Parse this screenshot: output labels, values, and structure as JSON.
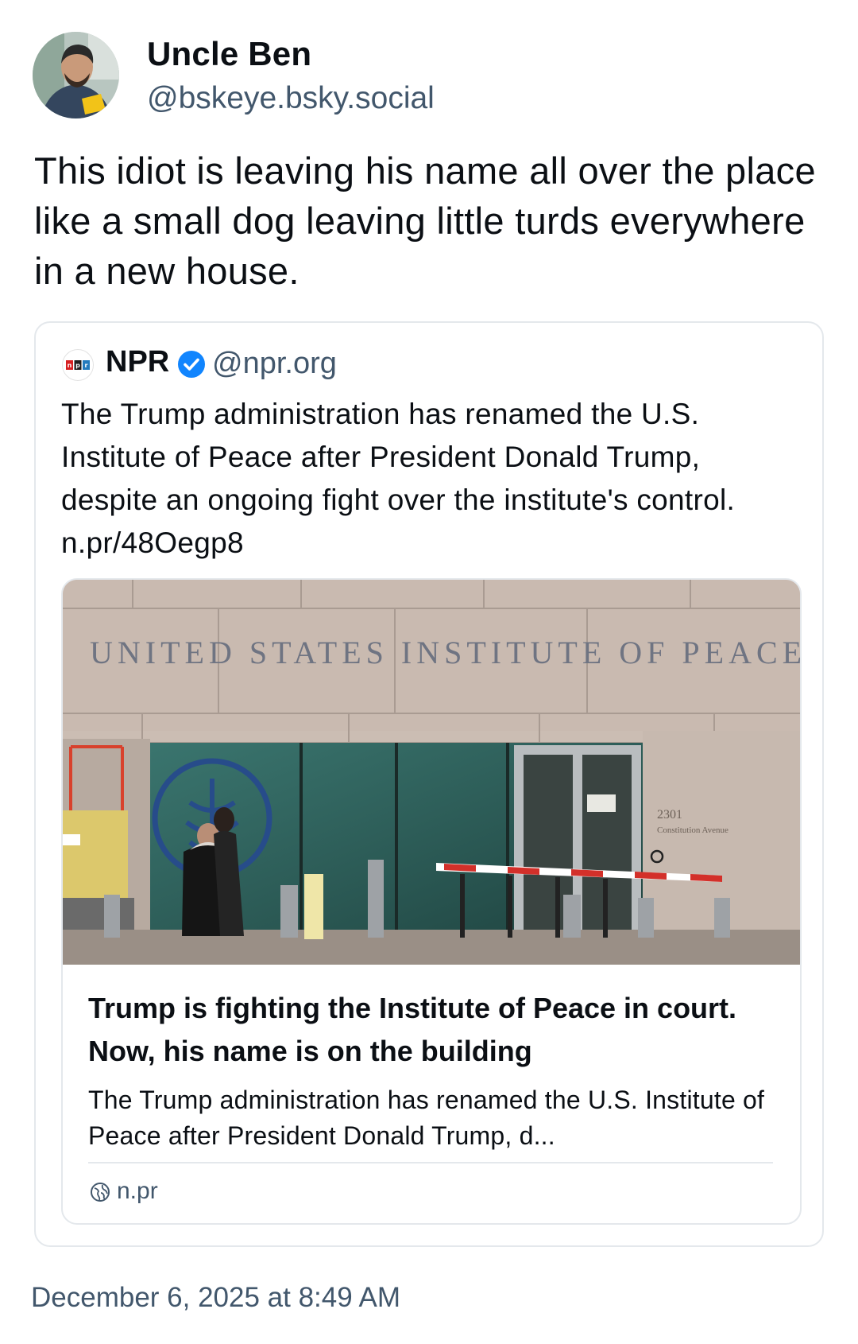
{
  "post": {
    "author": {
      "display_name": "Uncle Ben",
      "handle": "@bskeye.bsky.social"
    },
    "text": "This idiot is leaving his name all over the place like a small dog leaving little turds everywhere in a new house.",
    "timestamp": "December 6, 2025 at 8:49 AM"
  },
  "quote": {
    "author": {
      "display_name": "NPR",
      "handle": "@npr.org",
      "verified": true,
      "verified_color": "#1185fe",
      "logo_letters": "npr"
    },
    "text": "The Trump administration has renamed the U.S. Institute of Peace after President Donald Trump, despite an ongoing fight over the institute's control. n.pr/48Oegp8",
    "link_card": {
      "image": {
        "building_inscription": "UNITED STATES INSTITUTE OF PEACE",
        "address_number": "2301",
        "address_street": "Constitution Avenue"
      },
      "title": "Trump is fighting the Institute of Peace in court. Now, his name is on the building",
      "description": "The Trump administration has renamed the U.S. Institute of Peace after President Donald Trump, d...",
      "domain": "n.pr",
      "domain_icon": "globe-icon"
    }
  }
}
